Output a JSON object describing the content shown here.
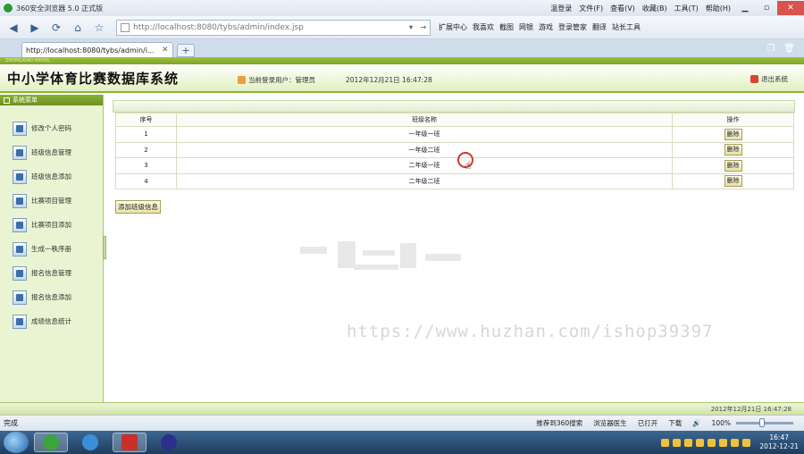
{
  "browser": {
    "window_title": "360安全浏览器 5.0 正式版",
    "title_menu": [
      "温登录",
      "文件(F)",
      "查看(V)",
      "收藏(B)",
      "工具(T)",
      "帮助(H)"
    ],
    "address": "http://localhost:8080/tybs/admin/index.jsp",
    "toolbar_items": [
      "扩展中心",
      "我喜欢",
      "截图",
      "网银",
      "游戏",
      "登录管家",
      "翻译",
      "站长工具"
    ],
    "tab_title": "http://localhost:8080/tybs/admin/i...",
    "status_text": "完成",
    "status_items": [
      "推荐到360搜索",
      "浏览器医生",
      "已打开",
      "下载"
    ],
    "zoom": "100%",
    "zoom_level": 0.45
  },
  "page": {
    "strip_text": "ZHONGXIAO SHOOL",
    "system_title": "中小学体育比赛数据库系统",
    "current_user_label": "当前登录用户：",
    "current_user": "管理员",
    "datetime": "2012年12月21日  16:47:28",
    "logout_label": "退出系统",
    "menu_header": "系统菜单",
    "menu_items": [
      {
        "label": "修改个人密码"
      },
      {
        "label": "班级信息管理"
      },
      {
        "label": "班级信息添加"
      },
      {
        "label": "比赛项目管理"
      },
      {
        "label": "比赛项目添加"
      },
      {
        "label": "生成一秩序册"
      },
      {
        "label": "报名信息管理"
      },
      {
        "label": "报名信息添加"
      },
      {
        "label": "成绩信息统计"
      }
    ],
    "table": {
      "columns": [
        "序号",
        "班级名称",
        "操作"
      ],
      "rows": [
        {
          "no": "1",
          "name": "一年级一班",
          "action": "删除"
        },
        {
          "no": "2",
          "name": "一年级二班",
          "action": "删除"
        },
        {
          "no": "3",
          "name": "二年级一班",
          "action": "删除"
        },
        {
          "no": "4",
          "name": "二年级二班",
          "action": "删除"
        }
      ]
    },
    "add_button": "添加班级信息",
    "footer_time": "2012年12月21日    16:47:28",
    "watermark": "https://www.huzhan.com/ishop39397"
  },
  "taskbar": {
    "clock_time": "16:47",
    "clock_date": "2012-12-21"
  },
  "colors": {
    "accent_green": "#8cb13a",
    "menu_bg": "#eaf4d2"
  }
}
